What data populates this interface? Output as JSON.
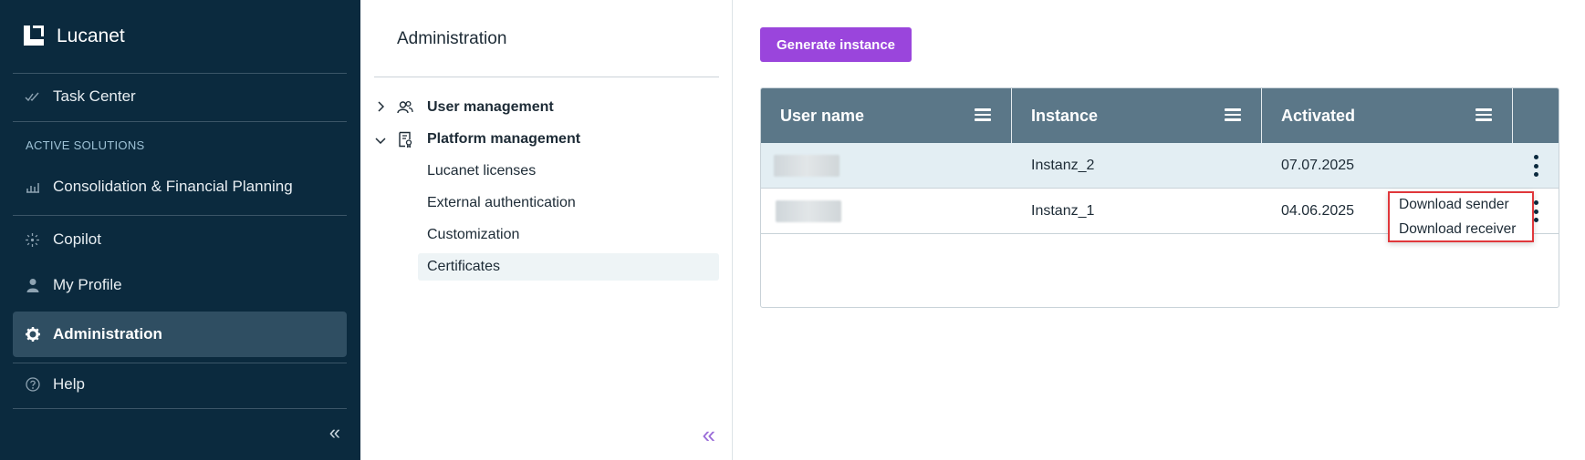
{
  "brand": {
    "name": "Lucanet"
  },
  "nav": {
    "task_center": "Task Center",
    "section_label": "ACTIVE SOLUTIONS",
    "consolidation": "Consolidation & Financial Planning",
    "copilot": "Copilot",
    "my_profile": "My Profile",
    "administration": "Administration",
    "help": "Help",
    "collapse_glyph": "«"
  },
  "admin_panel": {
    "title": "Administration",
    "user_management": "User management",
    "platform_management": "Platform management",
    "sub_items": [
      "Lucanet licenses",
      "External authentication",
      "Customization",
      "Certificates"
    ],
    "selected_sub_item": "Certificates",
    "collapse_glyph": "«"
  },
  "main": {
    "generate_button": "Generate instance",
    "columns": [
      "User name",
      "Instance",
      "Activated"
    ],
    "rows": [
      {
        "user_name": "",
        "instance": "Instanz_2",
        "activated": "07.07.2025",
        "selected": true
      },
      {
        "user_name": "",
        "instance": "Instanz_1",
        "activated": "04.06.2025",
        "selected": false
      }
    ],
    "context_menu": [
      "Download sender",
      "Download receiver"
    ]
  },
  "colors": {
    "nav_bg": "#0b2a3e",
    "nav_active": "#2f4e62",
    "accent_purple": "#9a45dc",
    "grid_header": "#5b7788",
    "highlight_red": "#e0373b"
  }
}
